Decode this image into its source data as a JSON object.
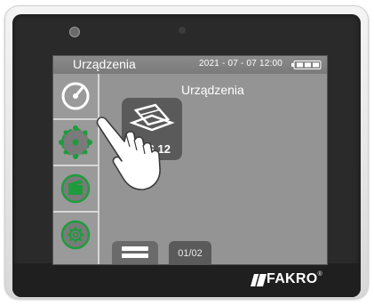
{
  "status_bar": {
    "title": "Urządzenia",
    "datetime": "2021 - 07 - 07  12:00",
    "battery_icon": "battery-icon",
    "battery_level_fraction": 1.0
  },
  "sidebar": {
    "items": [
      {
        "name": "devices",
        "icon": "devices-icon",
        "active": true
      },
      {
        "name": "groups",
        "icon": "groups-icon",
        "active": false
      },
      {
        "name": "scenarios",
        "icon": "scenarios-icon",
        "active": false
      },
      {
        "name": "settings",
        "icon": "gear-icon",
        "active": false
      }
    ]
  },
  "main": {
    "title": "Urządzenia",
    "device": {
      "label": "WS 12",
      "icon": "window-shade-icon"
    },
    "pointer_icon": "hand-pointer-icon"
  },
  "bottom": {
    "list_tab_icon": "list-icon",
    "page_indicator": "01/02"
  },
  "brand": {
    "logo_text": "FAKRO",
    "registered": "®"
  },
  "colors": {
    "accent_green": "#1e9c3c",
    "screen_gray": "#949494",
    "bezel": "#2a2a2a"
  }
}
